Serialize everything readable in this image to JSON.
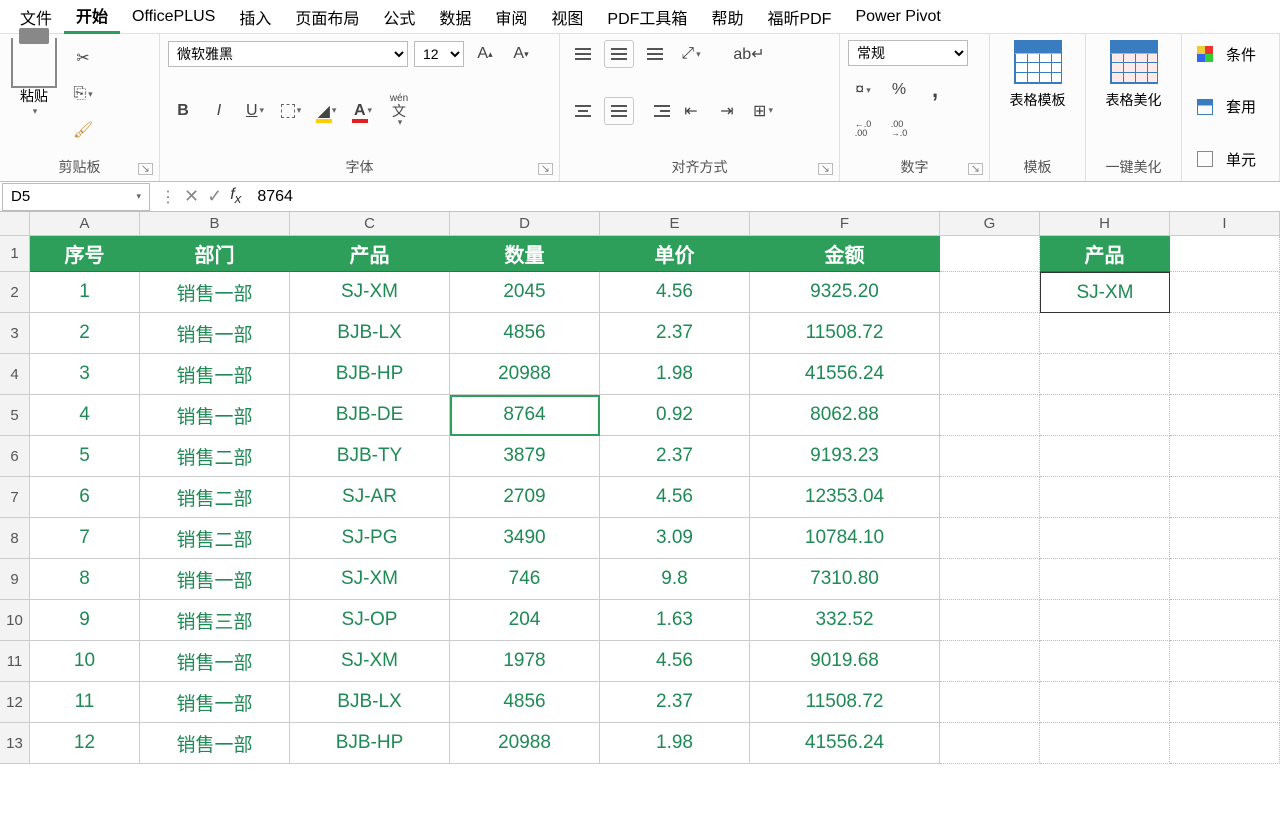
{
  "menu": [
    "文件",
    "开始",
    "OfficePLUS",
    "插入",
    "页面布局",
    "公式",
    "数据",
    "审阅",
    "视图",
    "PDF工具箱",
    "帮助",
    "福昕PDF",
    "Power Pivot"
  ],
  "active_menu_index": 1,
  "ribbon": {
    "clipboard": {
      "paste": "粘贴",
      "label": "剪贴板"
    },
    "font": {
      "name": "微软雅黑",
      "size": "12",
      "label": "字体",
      "wen": "wén"
    },
    "align": {
      "label": "对齐方式"
    },
    "number": {
      "format": "常规",
      "label": "数字",
      "percent": "%",
      "comma": ",",
      "inc": "←.0\n.00",
      "dec": ".00\n→.0"
    },
    "tmpl": {
      "label": "模板",
      "btn": "表格模板"
    },
    "beautify": {
      "label": "一键美化",
      "btn": "表格美化"
    },
    "style_items": [
      "条件",
      "套用",
      "单元"
    ]
  },
  "namebox": "D5",
  "formula": "8764",
  "columns": [
    "A",
    "B",
    "C",
    "D",
    "E",
    "F",
    "G",
    "H",
    "I"
  ],
  "table": {
    "headers": [
      "序号",
      "部门",
      "产品",
      "数量",
      "单价",
      "金额"
    ],
    "rows": [
      [
        "1",
        "销售一部",
        "SJ-XM",
        "2045",
        "4.56",
        "9325.20"
      ],
      [
        "2",
        "销售一部",
        "BJB-LX",
        "4856",
        "2.37",
        "11508.72"
      ],
      [
        "3",
        "销售一部",
        "BJB-HP",
        "20988",
        "1.98",
        "41556.24"
      ],
      [
        "4",
        "销售一部",
        "BJB-DE",
        "8764",
        "0.92",
        "8062.88"
      ],
      [
        "5",
        "销售二部",
        "BJB-TY",
        "3879",
        "2.37",
        "9193.23"
      ],
      [
        "6",
        "销售二部",
        "SJ-AR",
        "2709",
        "4.56",
        "12353.04"
      ],
      [
        "7",
        "销售二部",
        "SJ-PG",
        "3490",
        "3.09",
        "10784.10"
      ],
      [
        "8",
        "销售一部",
        "SJ-XM",
        "746",
        "9.8",
        "7310.80"
      ],
      [
        "9",
        "销售三部",
        "SJ-OP",
        "204",
        "1.63",
        "332.52"
      ],
      [
        "10",
        "销售一部",
        "SJ-XM",
        "1978",
        "4.56",
        "9019.68"
      ],
      [
        "11",
        "销售一部",
        "BJB-LX",
        "4856",
        "2.37",
        "11508.72"
      ],
      [
        "12",
        "销售一部",
        "BJB-HP",
        "20988",
        "1.98",
        "41556.24"
      ]
    ]
  },
  "side": {
    "header": "产品",
    "value": "SJ-XM"
  },
  "row_numbers": [
    "1",
    "2",
    "3",
    "4",
    "5",
    "6",
    "7",
    "8",
    "9",
    "10",
    "11",
    "12",
    "13"
  ]
}
